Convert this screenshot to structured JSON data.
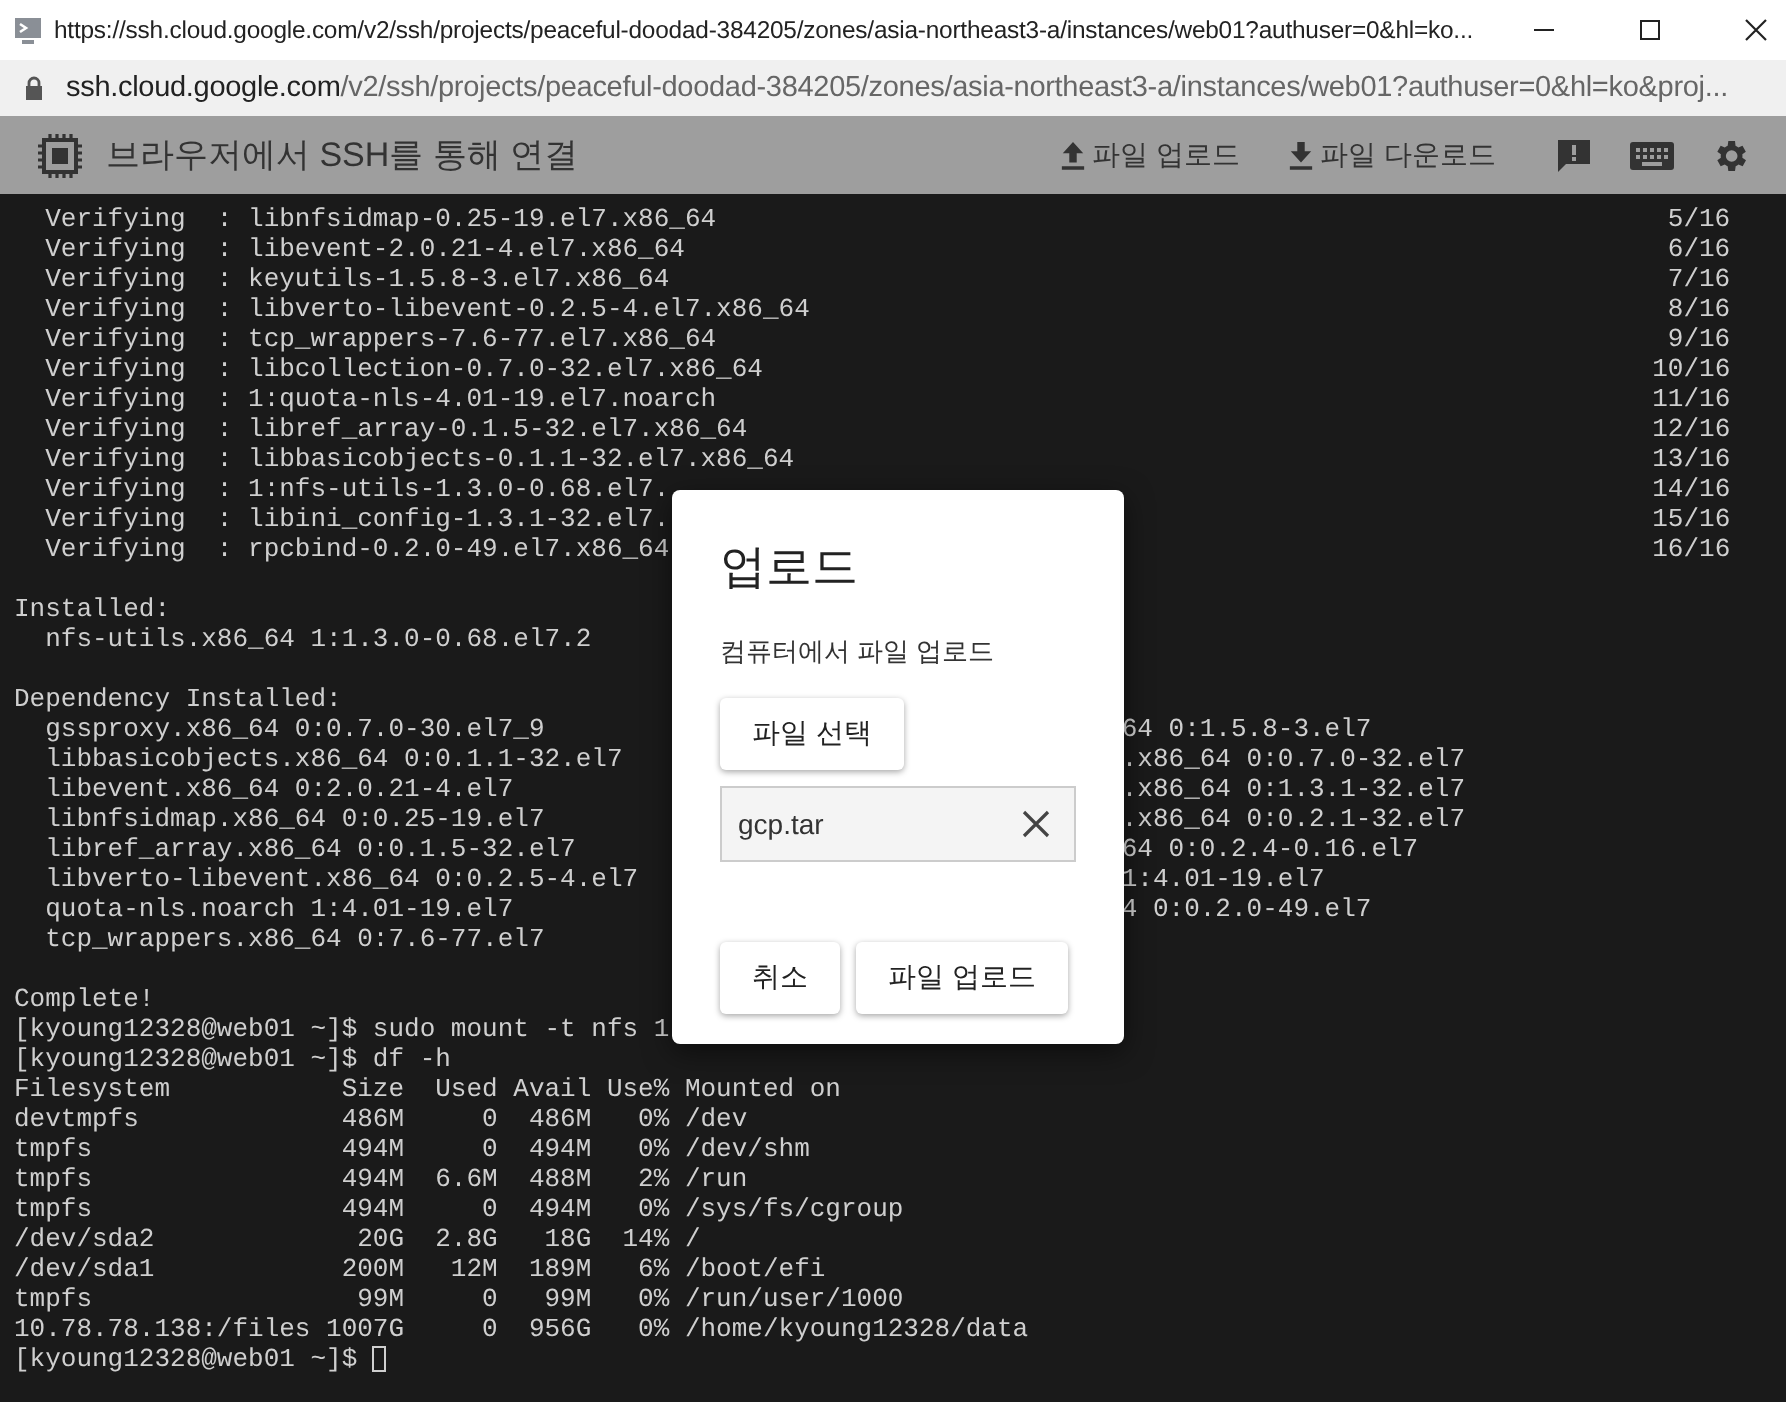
{
  "window": {
    "title": "https://ssh.cloud.google.com/v2/ssh/projects/peaceful-doodad-384205/zones/asia-northeast3-a/instances/web01?authuser=0&hl=ko..."
  },
  "address_bar": {
    "host": "ssh.cloud.google.com",
    "path": "/v2/ssh/projects/peaceful-doodad-384205/zones/asia-northeast3-a/instances/web01?authuser=0&hl=ko&proj..."
  },
  "header": {
    "title": "브라우저에서 SSH를 통해 연결",
    "actions": [
      {
        "kind": "upload",
        "label": "파일 업로드"
      },
      {
        "kind": "download",
        "label": "파일 다운로드"
      }
    ]
  },
  "terminal": {
    "lines": [
      {
        "kind": "progress",
        "text": "  Verifying  : libnfsidmap-0.25-19.el7.x86_64",
        "count": "5/16"
      },
      {
        "kind": "progress",
        "text": "  Verifying  : libevent-2.0.21-4.el7.x86_64",
        "count": "6/16"
      },
      {
        "kind": "progress",
        "text": "  Verifying  : keyutils-1.5.8-3.el7.x86_64",
        "count": "7/16"
      },
      {
        "kind": "progress",
        "text": "  Verifying  : libverto-libevent-0.2.5-4.el7.x86_64",
        "count": "8/16"
      },
      {
        "kind": "progress",
        "text": "  Verifying  : tcp_wrappers-7.6-77.el7.x86_64",
        "count": "9/16"
      },
      {
        "kind": "progress",
        "text": "  Verifying  : libcollection-0.7.0-32.el7.x86_64",
        "count": "10/16"
      },
      {
        "kind": "progress",
        "text": "  Verifying  : 1:quota-nls-4.01-19.el7.noarch",
        "count": "11/16"
      },
      {
        "kind": "progress",
        "text": "  Verifying  : libref_array-0.1.5-32.el7.x86_64",
        "count": "12/16"
      },
      {
        "kind": "progress",
        "text": "  Verifying  : libbasicobjects-0.1.1-32.el7.x86_64",
        "count": "13/16"
      },
      {
        "kind": "progress",
        "text": "  Verifying  : 1:nfs-utils-1.3.0-0.68.el7.",
        "count": "14/16"
      },
      {
        "kind": "progress",
        "text": "  Verifying  : libini_config-1.3.1-32.el7.",
        "count": "15/16"
      },
      {
        "kind": "progress",
        "text": "  Verifying  : rpcbind-0.2.0-49.el7.x86_64",
        "count": "16/16"
      },
      {
        "kind": "blank"
      },
      {
        "kind": "text",
        "text": "Installed:"
      },
      {
        "kind": "text",
        "text": "  nfs-utils.x86_64 1:1.3.0-0.68.el7.2"
      },
      {
        "kind": "blank"
      },
      {
        "kind": "text",
        "text": "Dependency Installed:"
      },
      {
        "kind": "split",
        "text": "  gssproxy.x86_64 0:0.7.0-30.el7_9",
        "right": "64 0:1.5.8-3.el7"
      },
      {
        "kind": "split",
        "text": "  libbasicobjects.x86_64 0:0.1.1-32.el7",
        "right": ".x86_64 0:0.7.0-32.el7"
      },
      {
        "kind": "split",
        "text": "  libevent.x86_64 0:2.0.21-4.el7",
        "right": ".x86_64 0:1.3.1-32.el7"
      },
      {
        "kind": "split",
        "text": "  libnfsidmap.x86_64 0:0.25-19.el7",
        "right": ".x86_64 0:0.2.1-32.el7"
      },
      {
        "kind": "split",
        "text": "  libref_array.x86_64 0:0.1.5-32.el7",
        "right": "64 0:0.2.4-0.16.el7"
      },
      {
        "kind": "split",
        "text": "  libverto-libevent.x86_64 0:0.2.5-4.el7",
        "right": "1:4.01-19.el7"
      },
      {
        "kind": "split",
        "text": "  quota-nls.noarch 1:4.01-19.el7",
        "right": "4 0:0.2.0-49.el7"
      },
      {
        "kind": "text",
        "text": "  tcp_wrappers.x86_64 0:7.6-77.el7"
      },
      {
        "kind": "blank"
      },
      {
        "kind": "text",
        "text": "Complete!"
      },
      {
        "kind": "text",
        "text": "[kyoung12328@web01 ~]$ sudo mount -t nfs 1"
      },
      {
        "kind": "text",
        "text": "[kyoung12328@web01 ~]$ df -h"
      },
      {
        "kind": "text",
        "text": "Filesystem           Size  Used Avail Use% Mounted on"
      },
      {
        "kind": "text",
        "text": "devtmpfs             486M     0  486M   0% /dev"
      },
      {
        "kind": "text",
        "text": "tmpfs                494M     0  494M   0% /dev/shm"
      },
      {
        "kind": "text",
        "text": "tmpfs                494M  6.6M  488M   2% /run"
      },
      {
        "kind": "text",
        "text": "tmpfs                494M     0  494M   0% /sys/fs/cgroup"
      },
      {
        "kind": "text",
        "text": "/dev/sda2             20G  2.8G   18G  14% /"
      },
      {
        "kind": "text",
        "text": "/dev/sda1            200M   12M  189M   6% /boot/efi"
      },
      {
        "kind": "text",
        "text": "tmpfs                 99M     0   99M   0% /run/user/1000"
      },
      {
        "kind": "text",
        "text": "10.78.78.138:/files 1007G     0  956G   0% /home/kyoung12328/data"
      },
      {
        "kind": "prompt",
        "text": "[kyoung12328@web01 ~]$ "
      }
    ]
  },
  "dialog": {
    "title": "업로드",
    "subtitle": "컴퓨터에서 파일 업로드",
    "choose_button": "파일 선택",
    "file_name": "gcp.tar",
    "buttons": [
      "취소",
      "파일 업로드"
    ]
  }
}
